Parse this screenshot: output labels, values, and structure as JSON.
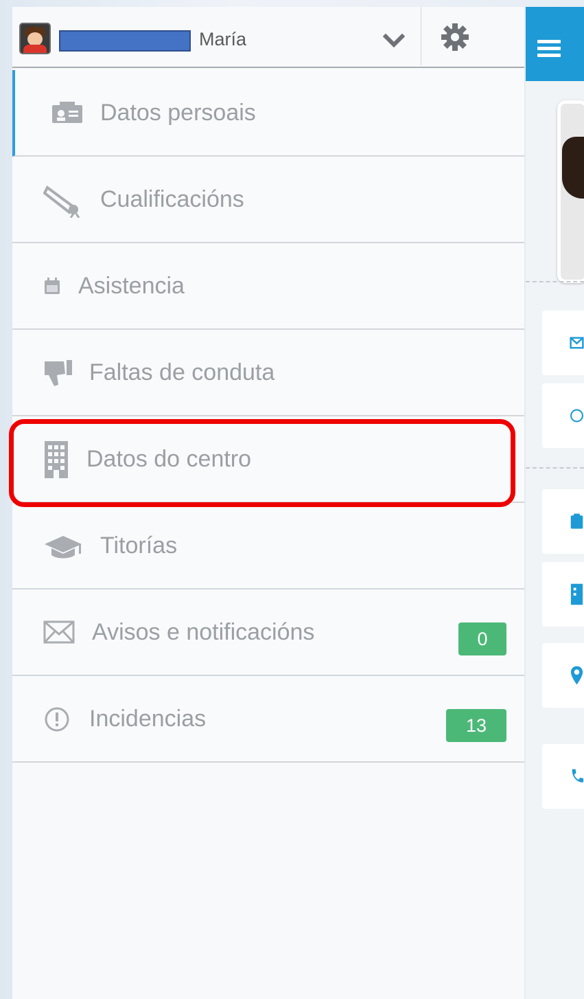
{
  "header": {
    "user_name": "María",
    "icons": {
      "expand": "chevron-down-icon",
      "settings": "gear-icon"
    }
  },
  "menu": {
    "items": [
      {
        "label": "Datos persoais",
        "icon": "id-card-icon",
        "active": true
      },
      {
        "label": "Cualificacións",
        "icon": "diploma-icon"
      },
      {
        "label": "Asistencia",
        "icon": "calendar-icon"
      },
      {
        "label": "Faltas de conduta",
        "icon": "thumbs-down-icon"
      },
      {
        "label": "Datos do centro",
        "icon": "building-icon",
        "highlighted": true
      },
      {
        "label": "Titorías",
        "icon": "graduation-cap-icon"
      },
      {
        "label": "Avisos e notificacións",
        "icon": "envelope-icon",
        "badge": "0"
      },
      {
        "label": "Incidencias",
        "icon": "exclamation-circle-icon",
        "badge": "13"
      }
    ]
  },
  "colors": {
    "accent": "#1e9ad6",
    "active_indicator": "#2e9be0",
    "badge": "#4cb877",
    "highlight": "#ef0000",
    "label_text": "#9b9fa3",
    "redaction": "#4472c4"
  },
  "content": {
    "topbar_icon": "hamburger-menu-icon",
    "side_icons": [
      "envelope-icon",
      "clock-icon",
      "clipboard-icon",
      "building-icon",
      "map-pin-icon",
      "phone-icon"
    ]
  }
}
